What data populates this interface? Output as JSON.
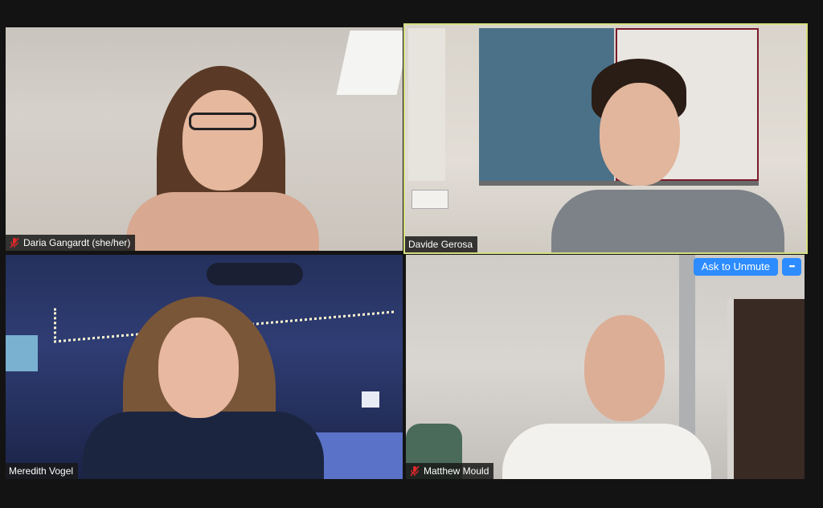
{
  "participants": [
    {
      "name": "Daria Gangardt (she/her)",
      "muted": true,
      "active_speaker": false
    },
    {
      "name": "Davide Gerosa",
      "muted": false,
      "active_speaker": true
    },
    {
      "name": "Meredith Vogel",
      "muted": false,
      "active_speaker": false
    },
    {
      "name": "Matthew Mould",
      "muted": true,
      "active_speaker": false
    }
  ],
  "tile_actions": {
    "ask_to_unmute_label": "Ask to Unmute",
    "more_label": "•••"
  },
  "colors": {
    "active_speaker_border": "#d5df7f",
    "muted_mic": "#e02828",
    "button_blue": "#2d8cff"
  },
  "icons": {
    "muted_mic": "microphone-muted-icon",
    "more": "ellipsis-icon"
  }
}
